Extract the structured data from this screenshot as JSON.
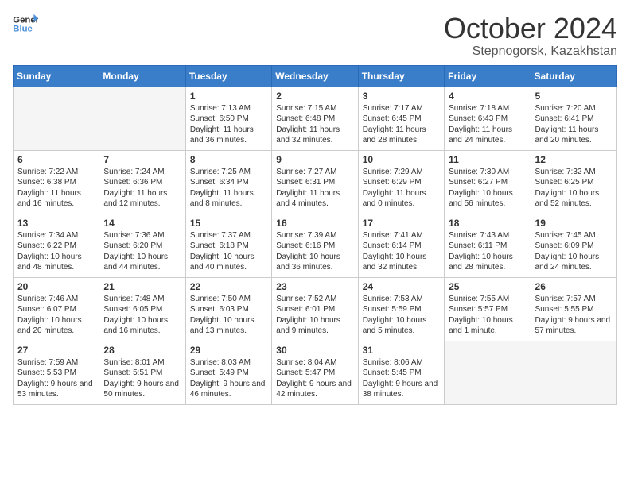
{
  "logo": {
    "line1": "General",
    "line2": "Blue"
  },
  "title": "October 2024",
  "subtitle": "Stepnogorsk, Kazakhstan",
  "days_of_week": [
    "Sunday",
    "Monday",
    "Tuesday",
    "Wednesday",
    "Thursday",
    "Friday",
    "Saturday"
  ],
  "weeks": [
    [
      {
        "num": "",
        "empty": true
      },
      {
        "num": "",
        "empty": true
      },
      {
        "num": "1",
        "sunrise": "7:13 AM",
        "sunset": "6:50 PM",
        "daylight": "11 hours and 36 minutes."
      },
      {
        "num": "2",
        "sunrise": "7:15 AM",
        "sunset": "6:48 PM",
        "daylight": "11 hours and 32 minutes."
      },
      {
        "num": "3",
        "sunrise": "7:17 AM",
        "sunset": "6:45 PM",
        "daylight": "11 hours and 28 minutes."
      },
      {
        "num": "4",
        "sunrise": "7:18 AM",
        "sunset": "6:43 PM",
        "daylight": "11 hours and 24 minutes."
      },
      {
        "num": "5",
        "sunrise": "7:20 AM",
        "sunset": "6:41 PM",
        "daylight": "11 hours and 20 minutes."
      }
    ],
    [
      {
        "num": "6",
        "sunrise": "7:22 AM",
        "sunset": "6:38 PM",
        "daylight": "11 hours and 16 minutes."
      },
      {
        "num": "7",
        "sunrise": "7:24 AM",
        "sunset": "6:36 PM",
        "daylight": "11 hours and 12 minutes."
      },
      {
        "num": "8",
        "sunrise": "7:25 AM",
        "sunset": "6:34 PM",
        "daylight": "11 hours and 8 minutes."
      },
      {
        "num": "9",
        "sunrise": "7:27 AM",
        "sunset": "6:31 PM",
        "daylight": "11 hours and 4 minutes."
      },
      {
        "num": "10",
        "sunrise": "7:29 AM",
        "sunset": "6:29 PM",
        "daylight": "11 hours and 0 minutes."
      },
      {
        "num": "11",
        "sunrise": "7:30 AM",
        "sunset": "6:27 PM",
        "daylight": "10 hours and 56 minutes."
      },
      {
        "num": "12",
        "sunrise": "7:32 AM",
        "sunset": "6:25 PM",
        "daylight": "10 hours and 52 minutes."
      }
    ],
    [
      {
        "num": "13",
        "sunrise": "7:34 AM",
        "sunset": "6:22 PM",
        "daylight": "10 hours and 48 minutes."
      },
      {
        "num": "14",
        "sunrise": "7:36 AM",
        "sunset": "6:20 PM",
        "daylight": "10 hours and 44 minutes."
      },
      {
        "num": "15",
        "sunrise": "7:37 AM",
        "sunset": "6:18 PM",
        "daylight": "10 hours and 40 minutes."
      },
      {
        "num": "16",
        "sunrise": "7:39 AM",
        "sunset": "6:16 PM",
        "daylight": "10 hours and 36 minutes."
      },
      {
        "num": "17",
        "sunrise": "7:41 AM",
        "sunset": "6:14 PM",
        "daylight": "10 hours and 32 minutes."
      },
      {
        "num": "18",
        "sunrise": "7:43 AM",
        "sunset": "6:11 PM",
        "daylight": "10 hours and 28 minutes."
      },
      {
        "num": "19",
        "sunrise": "7:45 AM",
        "sunset": "6:09 PM",
        "daylight": "10 hours and 24 minutes."
      }
    ],
    [
      {
        "num": "20",
        "sunrise": "7:46 AM",
        "sunset": "6:07 PM",
        "daylight": "10 hours and 20 minutes."
      },
      {
        "num": "21",
        "sunrise": "7:48 AM",
        "sunset": "6:05 PM",
        "daylight": "10 hours and 16 minutes."
      },
      {
        "num": "22",
        "sunrise": "7:50 AM",
        "sunset": "6:03 PM",
        "daylight": "10 hours and 13 minutes."
      },
      {
        "num": "23",
        "sunrise": "7:52 AM",
        "sunset": "6:01 PM",
        "daylight": "10 hours and 9 minutes."
      },
      {
        "num": "24",
        "sunrise": "7:53 AM",
        "sunset": "5:59 PM",
        "daylight": "10 hours and 5 minutes."
      },
      {
        "num": "25",
        "sunrise": "7:55 AM",
        "sunset": "5:57 PM",
        "daylight": "10 hours and 1 minute."
      },
      {
        "num": "26",
        "sunrise": "7:57 AM",
        "sunset": "5:55 PM",
        "daylight": "9 hours and 57 minutes."
      }
    ],
    [
      {
        "num": "27",
        "sunrise": "7:59 AM",
        "sunset": "5:53 PM",
        "daylight": "9 hours and 53 minutes."
      },
      {
        "num": "28",
        "sunrise": "8:01 AM",
        "sunset": "5:51 PM",
        "daylight": "9 hours and 50 minutes."
      },
      {
        "num": "29",
        "sunrise": "8:03 AM",
        "sunset": "5:49 PM",
        "daylight": "9 hours and 46 minutes."
      },
      {
        "num": "30",
        "sunrise": "8:04 AM",
        "sunset": "5:47 PM",
        "daylight": "9 hours and 42 minutes."
      },
      {
        "num": "31",
        "sunrise": "8:06 AM",
        "sunset": "5:45 PM",
        "daylight": "9 hours and 38 minutes."
      },
      {
        "num": "",
        "empty": true
      },
      {
        "num": "",
        "empty": true
      }
    ]
  ]
}
